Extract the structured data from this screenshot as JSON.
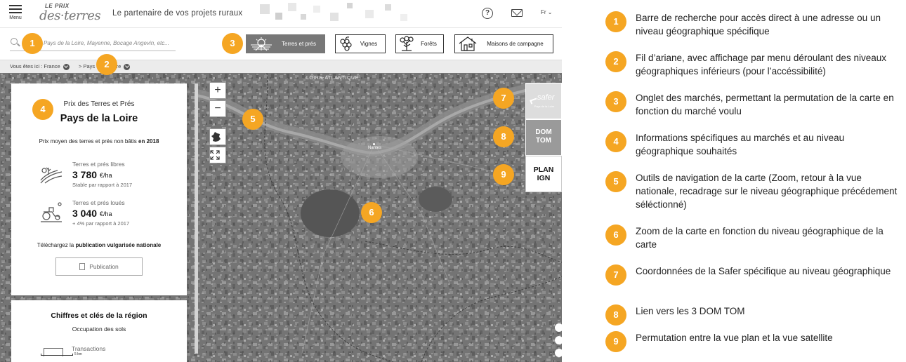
{
  "header": {
    "menu_label": "Menu",
    "logo_top": "LE PRIX",
    "logo_main": "des·terres",
    "tagline": "Le partenaire de vos projets ruraux",
    "help_glyph": "?",
    "lang": "Fr ⌄"
  },
  "search": {
    "placeholder": "Pays de la Loire, Mayenne, Bocage Angevin, etc..."
  },
  "markets": [
    {
      "label": "Terres et prés",
      "icon": "field-icon"
    },
    {
      "label": "Vignes",
      "icon": "grapes-icon"
    },
    {
      "label": "Forêts",
      "icon": "tree-icon"
    },
    {
      "label": "Maisons de campagne",
      "icon": "house-icon"
    }
  ],
  "breadcrumb": {
    "prefix": "Vous êtes ici : France",
    "current": "> Pays de la Loire"
  },
  "map": {
    "region_label": "LOIRE-ATLANTIQUE",
    "city_label": "Nantes",
    "scale_label": "5 km"
  },
  "panel": {
    "subtitle": "Prix des Terres et Prés",
    "title": "Pays de la Loire",
    "intro": "Prix moyen des terres et prés non bâtis",
    "intro_year": "en 2018",
    "rows": [
      {
        "label": "Terres et prés libres",
        "value": "3 780",
        "unit": "€/ha",
        "trend_prefix": "Stable",
        "trend_suffix": "par rapport à 2017"
      },
      {
        "label": "Terres et prés loués",
        "value": "3 040",
        "unit": "€/ha",
        "trend_prefix": "+ 4%",
        "trend_suffix": "par rapport à 2017"
      }
    ],
    "download_prefix": "Téléchargez la",
    "download_bold": "publication vulgarisée nationale",
    "publication_button": "Publication"
  },
  "panel2": {
    "title": "Chiffres et clés de la région",
    "subtitle": "Occupation des sols",
    "item": "Transactions"
  },
  "side_buttons": {
    "safer_label": "safer",
    "safer_sub": "Pays de la Loire",
    "domtom": "DOM TOM",
    "plan": "PLAN IGN"
  },
  "map_controls": {
    "zoom_in": "+",
    "zoom_out": "−"
  },
  "annotations": [
    {
      "n": "1",
      "text": "Barre de recherche pour accès direct à une adresse ou un niveau géographique spécifique"
    },
    {
      "n": "2",
      "text": "Fil d’ariane, avec affichage par menu déroulant des niveaux géographiques inférieurs (pour l’accéssibilité)"
    },
    {
      "n": "3",
      "text": "Onglet des marchés, permettant la permutation de la carte en fonction du marché voulu"
    },
    {
      "n": "4",
      "text": "Informations spécifiques au marchés et au niveau géographique souhaités"
    },
    {
      "n": "5",
      "text": "Outils de navigation de la carte (Zoom, retour à la vue nationale, recadrage sur le niveau géographique précédement séléctionné)"
    },
    {
      "n": "6",
      "text": "Zoom de la carte en fonction du niveau géographique de la carte"
    },
    {
      "n": "7",
      "text": "Coordonnées de la Safer spécifique au niveau géographique"
    },
    {
      "n": "8",
      "text": "Lien vers les 3 DOM TOM"
    },
    {
      "n": "9",
      "text": "Permutation entre la vue plan et la vue satellite"
    }
  ],
  "colors": {
    "badge": "#f5a623",
    "active_tab": "#777777",
    "map": "#6e6e6e"
  }
}
